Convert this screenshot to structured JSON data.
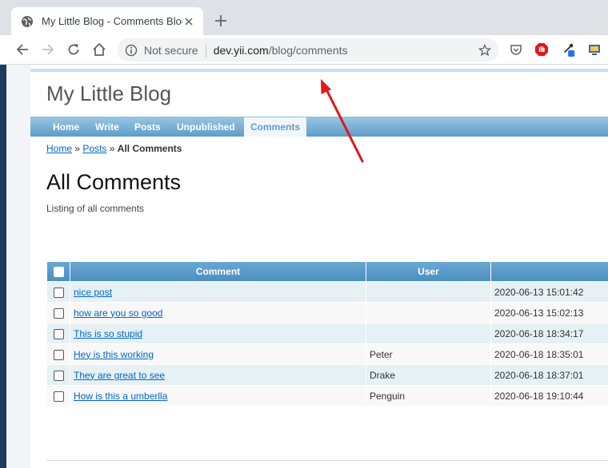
{
  "browser": {
    "tab": {
      "title": "My Little Blog - Comments Blog"
    },
    "omnibox": {
      "security": "Not secure",
      "host": "dev.yii.com",
      "path": "/blog/comments"
    }
  },
  "site": {
    "title": "My Little Blog",
    "menu": [
      {
        "label": "Home",
        "active": false
      },
      {
        "label": "Write",
        "active": false
      },
      {
        "label": "Posts",
        "active": false
      },
      {
        "label": "Unpublished",
        "active": false
      },
      {
        "label": "Comments",
        "active": true
      }
    ],
    "breadcrumbs": {
      "home": "Home",
      "sep1": "»",
      "posts": "Posts",
      "sep2": "»",
      "current": "All Comments"
    }
  },
  "page": {
    "heading": "All Comments",
    "description": "Listing of all comments"
  },
  "grid": {
    "headers": {
      "comment": "Comment",
      "user": "User"
    },
    "rows": [
      {
        "comment": "nice post",
        "user": "",
        "date": "2020-06-13 15:01:42"
      },
      {
        "comment": "how are you so good",
        "user": "",
        "date": "2020-06-13 15:02:13"
      },
      {
        "comment": "This is so stupid",
        "user": "",
        "date": "2020-06-18 18:34:17"
      },
      {
        "comment": "Hey is this working",
        "user": "Peter",
        "date": "2020-06-18 18:35:01"
      },
      {
        "comment": "They are great to see",
        "user": "Drake",
        "date": "2020-06-18 18:37:01"
      },
      {
        "comment": "How is this a umberlla",
        "user": "Penguin",
        "date": "2020-06-18 19:10:44"
      }
    ]
  },
  "colors": {
    "menu_blue": "#5d9dc8",
    "link": "#0066cc",
    "annotation_arrow": "#e3171b"
  }
}
